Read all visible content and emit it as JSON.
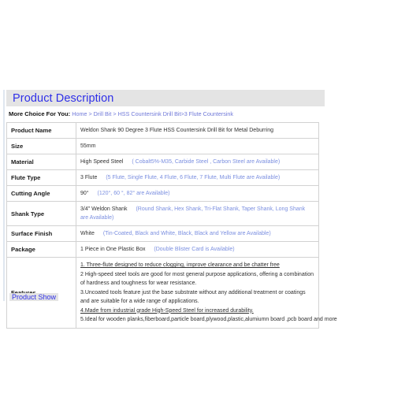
{
  "section": {
    "header_title": "Product Description",
    "breadcrumb_label": "More Choice For You:",
    "breadcrumb_trail": "Home > Drill Bit > HSS Countersink Drill Bit>3 Flute Countersink"
  },
  "spec_table": {
    "rows": [
      {
        "key": "Product Name",
        "value": "Weldon Shank 90 Degree 3 Flute HSS Countersink Drill Bit  for Metal Deburring",
        "alt": ""
      },
      {
        "key": "Size",
        "value": "55mm",
        "alt": ""
      },
      {
        "key": "Material",
        "value": "High Speed Steel",
        "alt": "( Cobalt5%-M35, Carbide Steel , Carbon Steel are Available)"
      },
      {
        "key": "Flute Type",
        "value": "3 Flute",
        "alt": "(5 Flute, Single Flute, 4 Flute,  6 Flute, 7 Flute, Multi Flute are Available)"
      },
      {
        "key": "Cutting Angle",
        "value": "90°",
        "alt": "(120°, 60 °, 82° are Available)"
      },
      {
        "key": "Shank Type",
        "value": "3/4\" Weldon Shank",
        "alt": "(Round Shank, Hex Shank,  Tri-Flat Shank, Taper Shank,  Long Shank  are Available)"
      },
      {
        "key": "Surface Finish",
        "value": "White",
        "alt": "(Tin-Coated, Black and White, Black, Black and Yellow are Available)"
      },
      {
        "key": "Package",
        "value": "1 Piece in One Plastic Box",
        "alt": "(Double Blister Card is Available)"
      }
    ],
    "features": {
      "key": "Features",
      "lines": [
        "1. Three-flute designed to reduce clogging, improve clearance and be chatter free",
        "2 High-speed steel tools are good for most general purpose applications, offering a combination of hardness and toughness for wear resistance.",
        "3.Uncoated tools feature just the base substrate without any additional treatment or coatings and are suitable for a wide range of applications.",
        "4.Made from industrial grade High-Speed Steel for increased durability.",
        "5.Ideal for wooden planks,fiberboard,particle board,plywood,plastic,alumiumn board ,pcb board and more"
      ]
    }
  },
  "below_section": {
    "clipped_title": "Product Show"
  },
  "colors": {
    "header_bg": "#e4e4e4",
    "header_text": "#2f2fe8",
    "alt_text": "#7b8fe0",
    "border": "#d2d2d2",
    "body_text": "#333333"
  }
}
